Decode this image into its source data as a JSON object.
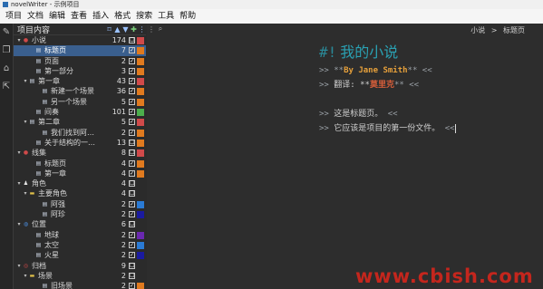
{
  "window": {
    "title": "novelWriter - 示例项目"
  },
  "menu": [
    "项目",
    "文档",
    "编辑",
    "查看",
    "插入",
    "格式",
    "搜索",
    "工具",
    "帮助"
  ],
  "sidebar_icons": [
    "edit-icon",
    "documents-icon",
    "outline-icon",
    "export-icon"
  ],
  "tree": {
    "header": "项目内容",
    "toolbar": [
      "bookmark-icon",
      "up-arrow-icon",
      "down-arrow-icon",
      "add-icon",
      "more-icon"
    ],
    "rows": [
      {
        "level": 0,
        "arrow": "▾",
        "icon": "●",
        "icolor": "#d04a4a",
        "label": "小说",
        "count": "174",
        "cb": "☐",
        "status": "#d04a4a",
        "sel": false
      },
      {
        "level": 2,
        "arrow": "",
        "icon": "▤",
        "icolor": "#cfd8e6",
        "label": "标题页",
        "count": "7",
        "cb": "✓",
        "status": "#e07a1f",
        "sel": true
      },
      {
        "level": 2,
        "arrow": "",
        "icon": "▤",
        "icolor": "#cfd8e6",
        "label": "页面",
        "count": "2",
        "cb": "✓",
        "status": "#e07a1f",
        "sel": false
      },
      {
        "level": 2,
        "arrow": "",
        "icon": "▤",
        "icolor": "#cfd8e6",
        "label": "第一部分",
        "count": "3",
        "cb": "✓",
        "status": "#e07a1f",
        "sel": false
      },
      {
        "level": 1,
        "arrow": "▾",
        "icon": "▤",
        "icolor": "#cfd8e6",
        "label": "第一章",
        "count": "43",
        "cb": "✓",
        "status": "#d04a4a",
        "sel": false
      },
      {
        "level": 3,
        "arrow": "",
        "icon": "▤",
        "icolor": "#cfd8e6",
        "label": "新建一个场景",
        "count": "36",
        "cb": "✓",
        "status": "#e07a1f",
        "sel": false
      },
      {
        "level": 3,
        "arrow": "",
        "icon": "▤",
        "icolor": "#cfd8e6",
        "label": "另一个场景",
        "count": "5",
        "cb": "✓",
        "status": "#e07a1f",
        "sel": false
      },
      {
        "level": 2,
        "arrow": "",
        "icon": "▤",
        "icolor": "#cfd8e6",
        "label": "间奏",
        "count": "101",
        "cb": "✓",
        "status": "#4cae4c",
        "sel": false
      },
      {
        "level": 1,
        "arrow": "▾",
        "icon": "▤",
        "icolor": "#cfd8e6",
        "label": "第二章",
        "count": "5",
        "cb": "✓",
        "status": "#d04a4a",
        "sel": false
      },
      {
        "level": 3,
        "arrow": "",
        "icon": "▤",
        "icolor": "#cfd8e6",
        "label": "我们找到阿…",
        "count": "2",
        "cb": "✓",
        "status": "#e07a1f",
        "sel": false
      },
      {
        "level": 2,
        "arrow": "",
        "icon": "▤",
        "icolor": "#cfd8e6",
        "label": "关于结构的一…",
        "count": "13",
        "cb": "☐",
        "status": "#e07a1f",
        "sel": false
      },
      {
        "level": 0,
        "arrow": "▾",
        "icon": "●",
        "icolor": "#d04a4a",
        "label": "线集",
        "count": "8",
        "cb": "☐",
        "status": "#d04a4a",
        "sel": false
      },
      {
        "level": 2,
        "arrow": "",
        "icon": "▤",
        "icolor": "#cfd8e6",
        "label": "标题页",
        "count": "4",
        "cb": "✓",
        "status": "#e07a1f",
        "sel": false
      },
      {
        "level": 2,
        "arrow": "",
        "icon": "▤",
        "icolor": "#cfd8e6",
        "label": "第一章",
        "count": "4",
        "cb": "✓",
        "status": "#e07a1f",
        "sel": false
      },
      {
        "level": 0,
        "arrow": "▾",
        "icon": "♟",
        "icolor": "#e8e8e8",
        "label": "角色",
        "count": "4",
        "cb": "☐",
        "status": "#2b2b2b",
        "sel": false
      },
      {
        "level": 1,
        "arrow": "▾",
        "icon": "▬",
        "icolor": "#e0c04a",
        "label": "主要角色",
        "count": "4",
        "cb": "☐",
        "status": "#2b2b2b",
        "sel": false
      },
      {
        "level": 3,
        "arrow": "",
        "icon": "▤",
        "icolor": "#cfd8e6",
        "label": "阿强",
        "count": "2",
        "cb": "✓",
        "status": "#2a7ad4",
        "sel": false
      },
      {
        "level": 3,
        "arrow": "",
        "icon": "▤",
        "icolor": "#cfd8e6",
        "label": "阿珍",
        "count": "2",
        "cb": "✓",
        "status": "#1a1aa0",
        "sel": false
      },
      {
        "level": 0,
        "arrow": "▾",
        "icon": "◍",
        "icolor": "#4a8ad8",
        "label": "位置",
        "count": "6",
        "cb": "☐",
        "status": "#2b2b2b",
        "sel": false
      },
      {
        "level": 2,
        "arrow": "",
        "icon": "▤",
        "icolor": "#cfd8e6",
        "label": "地球",
        "count": "2",
        "cb": "✓",
        "status": "#6a28b0",
        "sel": false
      },
      {
        "level": 2,
        "arrow": "",
        "icon": "▤",
        "icolor": "#cfd8e6",
        "label": "太空",
        "count": "2",
        "cb": "✓",
        "status": "#2a7ad4",
        "sel": false
      },
      {
        "level": 2,
        "arrow": "",
        "icon": "▤",
        "icolor": "#cfd8e6",
        "label": "火星",
        "count": "2",
        "cb": "✓",
        "status": "#1a1aa0",
        "sel": false
      },
      {
        "level": 0,
        "arrow": "▾",
        "icon": "◎",
        "icolor": "#d04a4a",
        "label": "归档",
        "count": "9",
        "cb": "☐",
        "status": "#2b2b2b",
        "sel": false
      },
      {
        "level": 1,
        "arrow": "▾",
        "icon": "▬",
        "icolor": "#e0c04a",
        "label": "场景",
        "count": "2",
        "cb": "☐",
        "status": "#2b2b2b",
        "sel": false
      },
      {
        "level": 3,
        "arrow": "",
        "icon": "▤",
        "icolor": "#cfd8e6",
        "label": "旧场景",
        "count": "2",
        "cb": "✓",
        "status": "#e07a1f",
        "sel": false
      }
    ]
  },
  "editor": {
    "breadcrumb": [
      "小说",
      ">",
      "标题页"
    ],
    "heading_mark": "#!",
    "heading": "我的小说",
    "lines": [
      [
        {
          "t": ">> **",
          "c": "g"
        },
        {
          "t": "By Jane Smith",
          "c": "o"
        },
        {
          "t": "** <<",
          "c": "g"
        }
      ],
      [
        {
          "t": ">> ",
          "c": "g"
        },
        {
          "t": "翻译: **",
          "c": "n"
        },
        {
          "t": "莫里克",
          "c": "r"
        },
        {
          "t": "** <<",
          "c": "g"
        }
      ],
      [],
      [
        {
          "t": ">> ",
          "c": "g"
        },
        {
          "t": "这是标题页。 ",
          "c": "n"
        },
        {
          "t": "<<",
          "c": "g"
        }
      ],
      [
        {
          "t": ">> ",
          "c": "g"
        },
        {
          "t": "它应该是项目的第一份文件。 ",
          "c": "n"
        },
        {
          "t": "<<",
          "c": "g"
        }
      ]
    ]
  },
  "watermark": "www.cbish.com"
}
